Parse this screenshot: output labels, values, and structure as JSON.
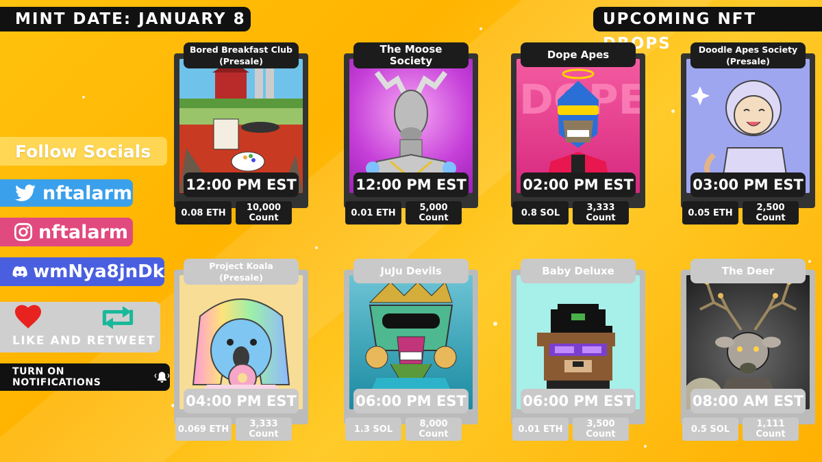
{
  "header": {
    "mint_date": "MINT DATE: JANUARY 8",
    "title": "UPCOMING NFT DROPS"
  },
  "socials": {
    "follow": "Follow Socials",
    "twitter": "nftalarm",
    "instagram": "nftalarm",
    "discord": "wmNya8jnDk",
    "like_retweet": "LIKE AND RETWEET",
    "notifications": "TURN ON NOTIFICATIONS"
  },
  "drops": [
    {
      "name": "Bored Breakfast Club (Presale)",
      "time": "12:00 PM EST",
      "price": "0.08 ETH",
      "count": "10,000",
      "count_label": "Count"
    },
    {
      "name": "The Moose Society",
      "time": "12:00 PM EST",
      "price": "0.01 ETH",
      "count": "5,000",
      "count_label": "Count"
    },
    {
      "name": "Dope Apes",
      "time": "02:00 PM EST",
      "price": "0.8 SOL",
      "count": "3,333",
      "count_label": "Count"
    },
    {
      "name": "Doodle Apes Society (Presale)",
      "time": "03:00 PM EST",
      "price": "0.05 ETH",
      "count": "2,500",
      "count_label": "Count"
    },
    {
      "name": "Project Koala (Presale)",
      "time": "04:00 PM EST",
      "price": "0.069 ETH",
      "count": "3,333",
      "count_label": "Count"
    },
    {
      "name": "JuJu Devils",
      "time": "06:00 PM EST",
      "price": "1.3 SOL",
      "count": "8,000",
      "count_label": "Count"
    },
    {
      "name": "Baby Deluxe",
      "time": "06:00 PM EST",
      "price": "0.01 ETH",
      "count": "3,500",
      "count_label": "Count"
    },
    {
      "name": "The Deer",
      "time": "08:00 AM EST",
      "price": "0.5 SOL",
      "count": "1,111",
      "count_label": "Count"
    }
  ],
  "icons": {
    "twitter": "twitter-bird-icon",
    "instagram": "instagram-icon",
    "discord": "discord-icon",
    "like": "heart-icon",
    "retweet": "retweet-icon",
    "bell": "bell-icon"
  },
  "colors": {
    "background": "#ffc20e",
    "twitter": "#3aa0ec",
    "instagram": "#e14a7e",
    "discord": "#4a5fe0",
    "heart": "#e8231f",
    "retweet": "#18b89a"
  }
}
